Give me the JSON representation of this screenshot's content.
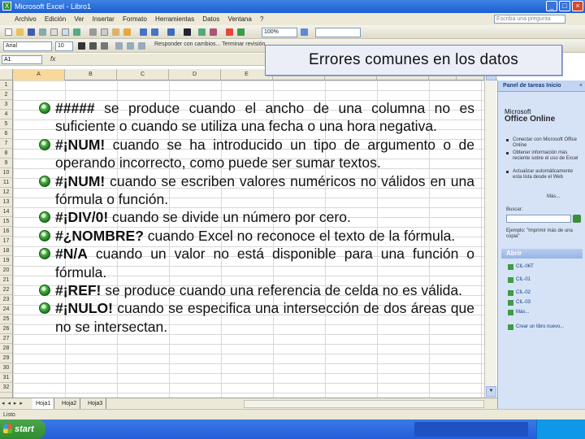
{
  "window": {
    "title": "Microsoft Excel - Libro1",
    "buttons": [
      "_",
      "□",
      "×"
    ]
  },
  "menu": {
    "items": [
      "Archivo",
      "Edición",
      "Ver",
      "Insertar",
      "Formato",
      "Herramientas",
      "Datos",
      "Ventana",
      "?"
    ],
    "help_placeholder": "Escriba una pregunta"
  },
  "toolbar": {
    "zoom": "100%",
    "font": "Arial",
    "font_size": "10",
    "comment_hint": "Responder con cambios... Terminar revisión"
  },
  "formula_bar": {
    "name_box": "A1",
    "fx": "fx"
  },
  "columns": [
    "A",
    "B",
    "C",
    "D",
    "E",
    "F",
    "G",
    "H",
    "I",
    "J"
  ],
  "rows": [
    "1",
    "2",
    "3",
    "4",
    "5",
    "6",
    "7",
    "8",
    "9",
    "10",
    "11",
    "12",
    "13",
    "14",
    "15",
    "16",
    "17",
    "18",
    "19",
    "20",
    "21",
    "22",
    "23",
    "24",
    "25",
    "26",
    "27",
    "28",
    "29",
    "30",
    "31",
    "32"
  ],
  "sheets": [
    "Hoja1",
    "Hoja2",
    "Hoja3"
  ],
  "sheet_nav": "◂ ◂ ▸ ▸",
  "status": "Listo",
  "taskbar": {
    "start_label": "start"
  },
  "task_pane": {
    "title": "Panel de tareas Inicio",
    "office_prefix": "Microsoft",
    "office_name": "Office Online",
    "links": [
      "Conectar con Microsoft Office Online",
      "Obtener información más reciente sobre el uso de Excel",
      "Actualizar automáticamente esta lista desde el Web",
      "Más..."
    ],
    "search_label": "Buscar:",
    "example": "Ejemplo: \"Imprimir más de una copia\"",
    "open_header": "Abrir",
    "files": [
      "CIL-06T",
      "CIL-01",
      "CIL-02",
      "CIL-03",
      "Más..."
    ],
    "new_book": "Crear un libro nuevo..."
  },
  "slide": {
    "title": "Errores comunes en los datos",
    "bullets": [
      {
        "code": "#####",
        "text": " se produce cuando el ancho de una columna no es suficiente o cuando se utiliza una fecha o una hora negativa."
      },
      {
        "code": "#¡NUM!",
        "text": " cuando se ha introducido un tipo de argumento o de operando incorrecto, como puede ser sumar textos."
      },
      {
        "code": "#¡NUM!",
        "text": " cuando se escriben valores numéricos no válidos en una fórmula o función."
      },
      {
        "code": "#¡DIV/0!",
        "text": " cuando se divide un número por cero."
      },
      {
        "code": "#¿NOMBRE?",
        "text": " cuando Excel no reconoce el texto de la fórmula."
      },
      {
        "code": "#N/A",
        "text": " cuando un valor no está disponible para una función o fórmula."
      },
      {
        "code": "#¡REF!",
        "text": " se produce cuando una referencia de celda no es válida."
      },
      {
        "code": "#¡NULO!",
        "text": " cuando se especifica una intersección de dos áreas que no se intersectan."
      }
    ]
  }
}
